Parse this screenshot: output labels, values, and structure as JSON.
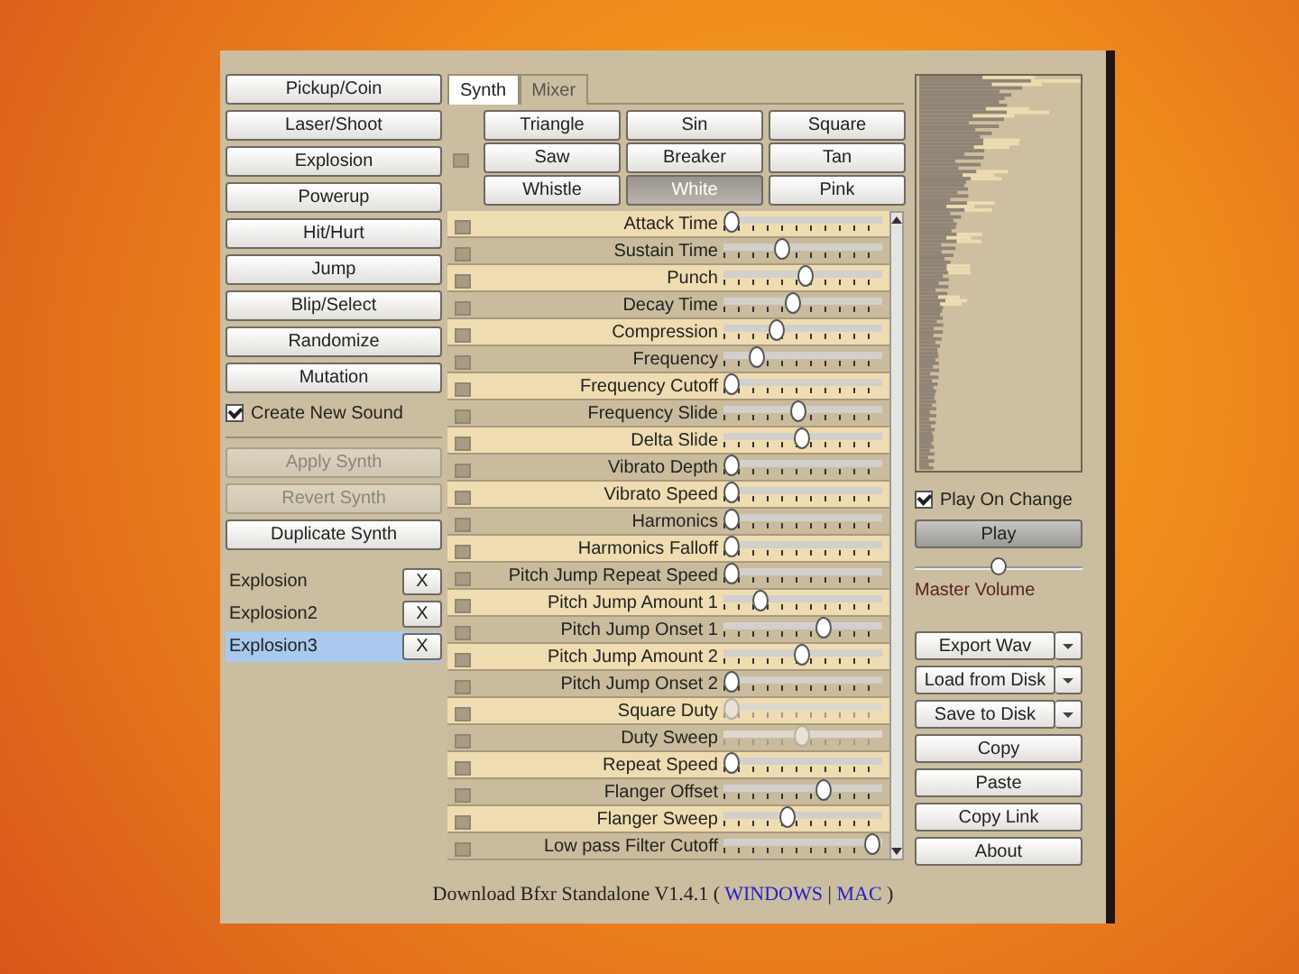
{
  "left_panel": {
    "preset_buttons": [
      "Pickup/Coin",
      "Laser/Shoot",
      "Explosion",
      "Powerup",
      "Hit/Hurt",
      "Jump",
      "Blip/Select",
      "Randomize",
      "Mutation"
    ],
    "create_new_sound": {
      "label": "Create New Sound",
      "checked": true
    },
    "actions": [
      {
        "label": "Apply Synth",
        "disabled": true
      },
      {
        "label": "Revert Synth",
        "disabled": true
      },
      {
        "label": "Duplicate Synth",
        "disabled": false
      }
    ],
    "sounds": [
      {
        "name": "Explosion",
        "selected": false,
        "delete": "X"
      },
      {
        "name": "Explosion2",
        "selected": false,
        "delete": "X"
      },
      {
        "name": "Explosion3",
        "selected": true,
        "delete": "X"
      }
    ]
  },
  "tabs": [
    {
      "label": "Synth",
      "selected": true
    },
    {
      "label": "Mixer",
      "selected": false
    }
  ],
  "waveforms": [
    {
      "label": "Triangle",
      "selected": false
    },
    {
      "label": "Sin",
      "selected": false
    },
    {
      "label": "Square",
      "selected": false
    },
    {
      "label": "Saw",
      "selected": false
    },
    {
      "label": "Breaker",
      "selected": false
    },
    {
      "label": "Tan",
      "selected": false
    },
    {
      "label": "Whistle",
      "selected": false
    },
    {
      "label": "White",
      "selected": true
    },
    {
      "label": "Pink",
      "selected": false
    }
  ],
  "sliders": [
    {
      "label": "Attack Time",
      "level": 0,
      "disabled": false
    },
    {
      "label": "Sustain Time",
      "level": 0.36,
      "disabled": false
    },
    {
      "label": "Punch",
      "level": 0.52,
      "disabled": false
    },
    {
      "label": "Decay Time",
      "level": 0.43,
      "disabled": false
    },
    {
      "label": "Compression",
      "level": 0.32,
      "disabled": false
    },
    {
      "label": "Frequency",
      "level": 0.18,
      "disabled": false
    },
    {
      "label": "Frequency Cutoff",
      "level": 0,
      "disabled": false
    },
    {
      "label": "Frequency Slide",
      "level": 0.47,
      "disabled": false
    },
    {
      "label": "Delta Slide",
      "level": 0.5,
      "disabled": false
    },
    {
      "label": "Vibrato Depth",
      "level": 0,
      "disabled": false
    },
    {
      "label": "Vibrato Speed",
      "level": 0,
      "disabled": false
    },
    {
      "label": "Harmonics",
      "level": 0,
      "disabled": false
    },
    {
      "label": "Harmonics Falloff",
      "level": 0,
      "disabled": false
    },
    {
      "label": "Pitch Jump Repeat Speed",
      "level": 0,
      "disabled": false
    },
    {
      "label": "Pitch Jump Amount 1",
      "level": 0.2,
      "disabled": false
    },
    {
      "label": "Pitch Jump Onset 1",
      "level": 0.66,
      "disabled": false
    },
    {
      "label": "Pitch Jump Amount 2",
      "level": 0.5,
      "disabled": false
    },
    {
      "label": "Pitch Jump Onset 2",
      "level": 0,
      "disabled": false
    },
    {
      "label": "Square Duty",
      "level": 0,
      "disabled": true
    },
    {
      "label": "Duty Sweep",
      "level": 0.5,
      "disabled": true
    },
    {
      "label": "Repeat Speed",
      "level": 0,
      "disabled": false
    },
    {
      "label": "Flanger Offset",
      "level": 0.66,
      "disabled": false
    },
    {
      "label": "Flanger Sweep",
      "level": 0.4,
      "disabled": false
    },
    {
      "label": "Low pass Filter Cutoff",
      "level": 1,
      "disabled": false
    }
  ],
  "right_panel": {
    "play_on_change": {
      "label": "Play On Change",
      "checked": true
    },
    "play_button": "Play",
    "master_volume": {
      "label": "Master Volume",
      "level": 0.5
    },
    "buttons": [
      {
        "label": "Export Wav",
        "dropdown": true
      },
      {
        "label": "Load from Disk",
        "dropdown": true
      },
      {
        "label": "Save to Disk",
        "dropdown": true
      },
      {
        "label": "Copy",
        "dropdown": false
      },
      {
        "label": "Paste",
        "dropdown": false
      },
      {
        "label": "Copy Link",
        "dropdown": false
      },
      {
        "label": "About",
        "dropdown": false
      }
    ]
  },
  "footer": {
    "parts": [
      {
        "kind": "text",
        "text": "Download Bfxr Standalone V1.4.1 ( "
      },
      {
        "kind": "link",
        "text": "WINDOWS"
      },
      {
        "kind": "text",
        "text": " | "
      },
      {
        "kind": "link",
        "text": "MAC"
      },
      {
        "kind": "text",
        "text": " )"
      }
    ]
  }
}
